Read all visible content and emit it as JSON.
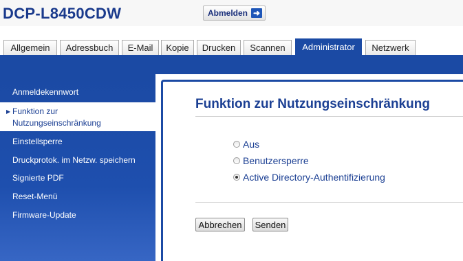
{
  "header": {
    "model": "DCP-L8450CDW",
    "logout_label": "Abmelden"
  },
  "tabs": [
    {
      "label": "Allgemein",
      "active": false
    },
    {
      "label": "Adressbuch",
      "active": false
    },
    {
      "label": "E-Mail",
      "active": false
    },
    {
      "label": "Kopie",
      "active": false
    },
    {
      "label": "Drucken",
      "active": false
    },
    {
      "label": "Scannen",
      "active": false
    },
    {
      "label": "Administrator",
      "active": true
    },
    {
      "label": "Netzwerk",
      "active": false
    }
  ],
  "sidebar": {
    "items": [
      {
        "label": "Anmeldekennwort"
      },
      {
        "label": "Funktion zur Nutzungseinschränkung",
        "line1": "Funktion zur",
        "line2": "Nutzungseinschränkung",
        "active": true
      },
      {
        "label": "Einstellsperre"
      },
      {
        "label": "Druckprotok. im Netzw. speichern"
      },
      {
        "label": "Signierte PDF"
      },
      {
        "label": "Reset-Menü"
      },
      {
        "label": "Firmware-Update"
      }
    ]
  },
  "main": {
    "title": "Funktion zur Nutzungseinschränkung",
    "options": [
      {
        "label": "Aus",
        "checked": false
      },
      {
        "label": "Benutzersperre",
        "checked": false
      },
      {
        "label": "Active Directory-Authentifizierung",
        "checked": true
      }
    ],
    "cancel_label": "Abbrechen",
    "submit_label": "Senden"
  },
  "colors": {
    "brand_blue": "#1b4aa4",
    "title_blue": "#1b3f93"
  }
}
